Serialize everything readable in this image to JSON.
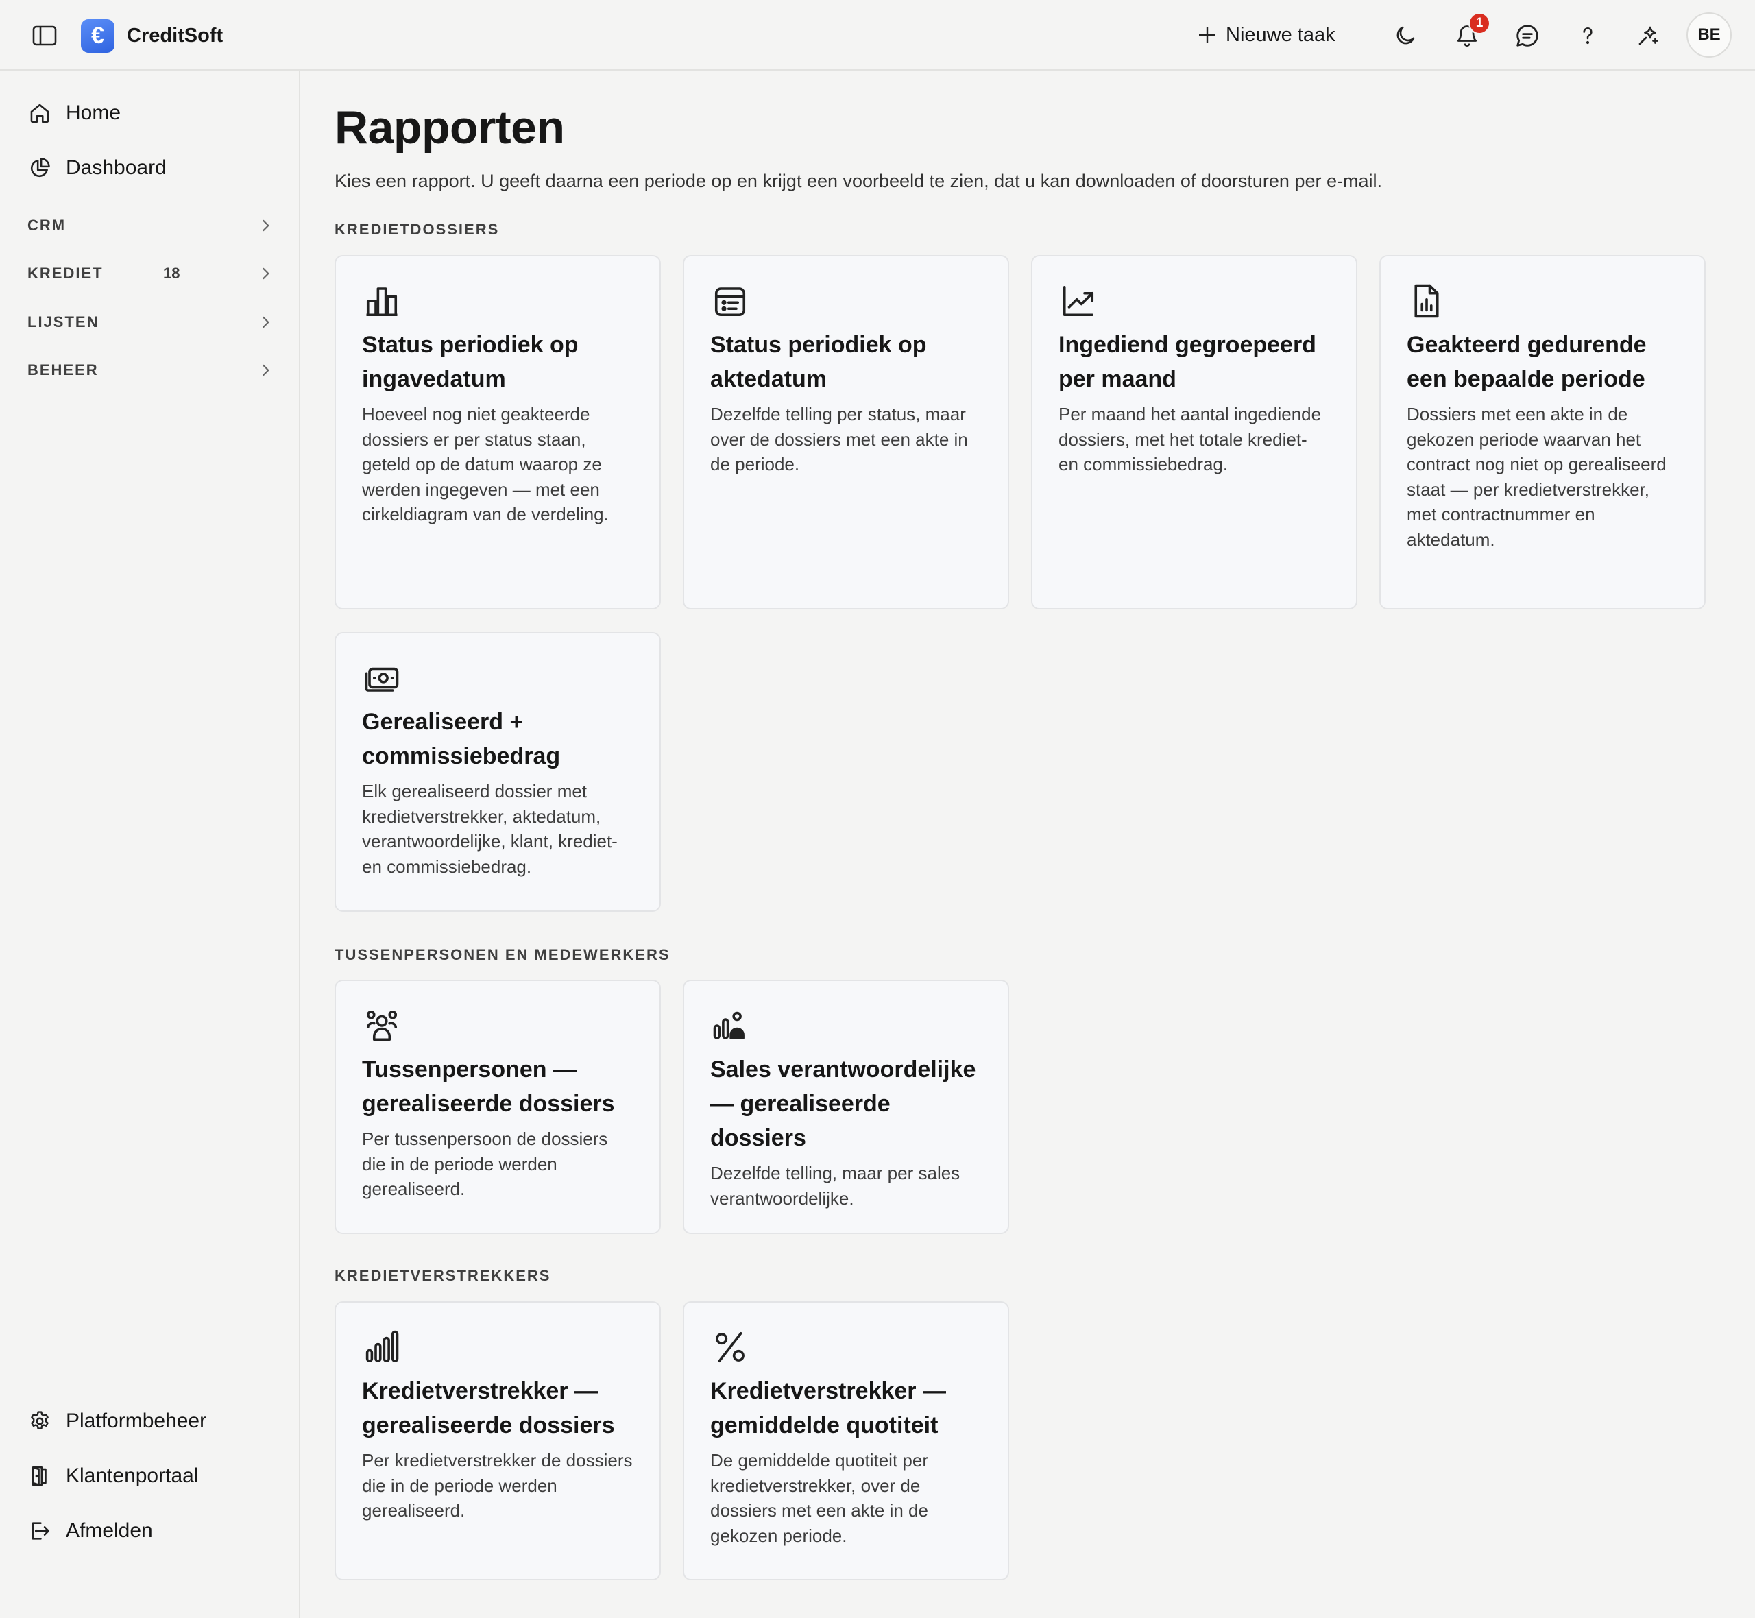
{
  "app": {
    "name": "CreditSoft",
    "logo_glyph": "€"
  },
  "topbar": {
    "new_task_label": "Nieuwe taak",
    "notification_count": "1",
    "avatar_initials": "BE"
  },
  "sidebar": {
    "home": "Home",
    "dashboard": "Dashboard",
    "groups": [
      {
        "label": "CRM",
        "count": ""
      },
      {
        "label": "KREDIET",
        "count": "18"
      },
      {
        "label": "LIJSTEN",
        "count": ""
      },
      {
        "label": "BEHEER",
        "count": ""
      }
    ],
    "bottom": {
      "platform": "Platformbeheer",
      "portal": "Klantenportaal",
      "logout": "Afmelden"
    }
  },
  "page": {
    "title": "Rapporten",
    "intro": "Kies een rapport. U geeft daarna een periode op en krijgt een voorbeeld te zien, dat u kan downloaden of doorsturen per e-mail."
  },
  "sections": [
    {
      "title": "KREDIETDOSSIERS",
      "cards": [
        {
          "icon": "bar-chart-icon",
          "title": "Status periodiek op ingavedatum",
          "desc": "Hoeveel nog niet geakteerde dossiers er per status staan, geteld op de datum waarop ze werden ingegeven — met een cirkeldiagram van de verdeling."
        },
        {
          "icon": "calendar-list-icon",
          "title": "Status periodiek op aktedatum",
          "desc": "Dezelfde telling per status, maar over de dossiers met een akte in de periode."
        },
        {
          "icon": "trending-up-icon",
          "title": "Ingediend gegroepeerd per maand",
          "desc": "Per maand het aantal ingediende dossiers, met het totale krediet- en commissiebedrag."
        },
        {
          "icon": "file-chart-icon",
          "title": "Geakteerd gedurende een bepaalde periode",
          "desc": "Dossiers met een akte in de gekozen periode waarvan het contract nog niet op gerealiseerd staat — per kredietverstrekker, met contractnummer en aktedatum."
        },
        {
          "icon": "banknote-icon",
          "title": "Gerealiseerd + commissiebedrag",
          "desc": "Elk gerealiseerd dossier met kredietverstrekker, aktedatum, verantwoordelijke, klant, krediet- en commissiebedrag."
        }
      ]
    },
    {
      "title": "TUSSENPERSONEN EN MEDEWERKERS",
      "cards": [
        {
          "icon": "users-group-icon",
          "title": "Tussenpersonen — gerealiseerde dossiers",
          "desc": "Per tussenpersoon de dossiers die in de periode werden gerealiseerd."
        },
        {
          "icon": "user-chart-icon",
          "title": "Sales verantwoordelijke — gerealiseerde dossiers",
          "desc": "Dezelfde telling, maar per sales verantwoordelijke."
        }
      ]
    },
    {
      "title": "KREDIETVERSTREKKERS",
      "cards": [
        {
          "icon": "signal-bars-icon",
          "title": "Kredietverstrekker — gerealiseerde dossiers",
          "desc": "Per kredietverstrekker de dossiers die in de periode werden gerealiseerd."
        },
        {
          "icon": "percent-icon",
          "title": "Kredietverstrekker — gemiddelde quotiteit",
          "desc": "De gemiddelde quotiteit per kredietverstrekker, over de dossiers met een akte in de gekozen periode."
        }
      ]
    }
  ]
}
